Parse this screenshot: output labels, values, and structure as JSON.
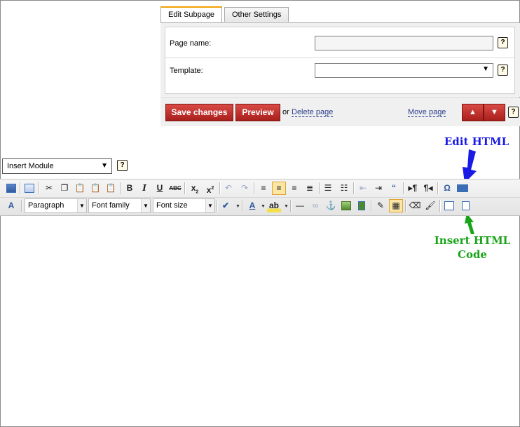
{
  "tabs": [
    {
      "label": "Edit Subpage"
    },
    {
      "label": "Other Settings"
    }
  ],
  "form": {
    "page_name_label": "Page name:",
    "page_name_value": "",
    "template_label": "Template:",
    "template_value": ""
  },
  "actions": {
    "save_label": "Save changes",
    "preview_label": "Preview",
    "or_text": "or",
    "delete_label": "Delete page",
    "move_label": "Move page"
  },
  "help_glyph": "?",
  "annotations": {
    "edit_html": "Edit HTML",
    "insert_html_line1": "Insert HTML",
    "insert_html_line2": "Code"
  },
  "module_select": {
    "value": "Insert Module"
  },
  "toolbar": {
    "format_value": "Paragraph",
    "font_family_value": "Font family",
    "font_size_value": "Font size"
  },
  "colors": {
    "brand_red": "#b52a26",
    "annotation_blue": "#1a1ae6",
    "annotation_green": "#1aa41a",
    "active_tab_accent": "#f0a000"
  }
}
